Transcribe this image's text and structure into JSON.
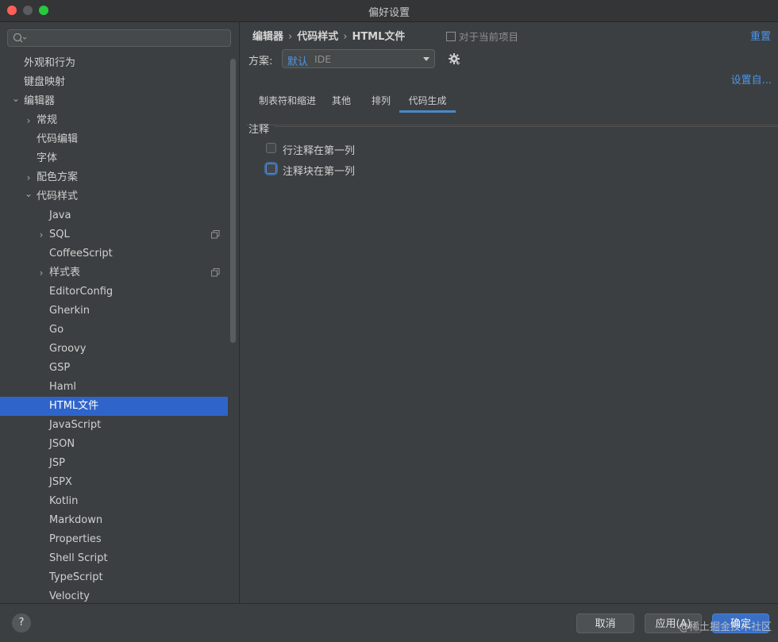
{
  "window": {
    "title": "偏好设置"
  },
  "search": {
    "placeholder": ""
  },
  "tree": [
    {
      "label": "外观和行为",
      "level": 0,
      "chevron": ""
    },
    {
      "label": "键盘映射",
      "level": 0,
      "chevron": ""
    },
    {
      "label": "编辑器",
      "level": 0,
      "chevron": "down"
    },
    {
      "label": "常规",
      "level": 1,
      "chevron": "right"
    },
    {
      "label": "代码编辑",
      "level": 1,
      "chevron": ""
    },
    {
      "label": "字体",
      "level": 1,
      "chevron": ""
    },
    {
      "label": "配色方案",
      "level": 1,
      "chevron": "right"
    },
    {
      "label": "代码样式",
      "level": 1,
      "chevron": "down"
    },
    {
      "label": "Java",
      "level": 2,
      "chevron": ""
    },
    {
      "label": "SQL",
      "level": 2,
      "chevron": "right",
      "copy": true
    },
    {
      "label": "CoffeeScript",
      "level": 2,
      "chevron": ""
    },
    {
      "label": "样式表",
      "level": 2,
      "chevron": "right",
      "copy": true
    },
    {
      "label": "EditorConfig",
      "level": 2,
      "chevron": ""
    },
    {
      "label": "Gherkin",
      "level": 2,
      "chevron": ""
    },
    {
      "label": "Go",
      "level": 2,
      "chevron": ""
    },
    {
      "label": "Groovy",
      "level": 2,
      "chevron": ""
    },
    {
      "label": "GSP",
      "level": 2,
      "chevron": ""
    },
    {
      "label": "Haml",
      "level": 2,
      "chevron": ""
    },
    {
      "label": "HTML文件",
      "level": 2,
      "chevron": "",
      "selected": true
    },
    {
      "label": "JavaScript",
      "level": 2,
      "chevron": ""
    },
    {
      "label": "JSON",
      "level": 2,
      "chevron": ""
    },
    {
      "label": "JSP",
      "level": 2,
      "chevron": ""
    },
    {
      "label": "JSPX",
      "level": 2,
      "chevron": ""
    },
    {
      "label": "Kotlin",
      "level": 2,
      "chevron": ""
    },
    {
      "label": "Markdown",
      "level": 2,
      "chevron": ""
    },
    {
      "label": "Properties",
      "level": 2,
      "chevron": ""
    },
    {
      "label": "Shell Script",
      "level": 2,
      "chevron": ""
    },
    {
      "label": "TypeScript",
      "level": 2,
      "chevron": ""
    },
    {
      "label": "Velocity",
      "level": 2,
      "chevron": ""
    }
  ],
  "breadcrumb": {
    "part1": "编辑器",
    "part2": "代码样式",
    "part3": "HTML文件",
    "sep": "›"
  },
  "project_scope": "对于当前项目",
  "reset_label": "重置",
  "scheme": {
    "label": "方案:",
    "value": "默认",
    "sub": "IDE"
  },
  "settings_link": "设置自...",
  "tabs": [
    {
      "label": "制表符和缩进",
      "active": false
    },
    {
      "label": "其他",
      "active": false
    },
    {
      "label": "排列",
      "active": false
    },
    {
      "label": "代码生成",
      "active": true
    }
  ],
  "comment_group": {
    "title": "注释",
    "options": [
      {
        "label": "行注释在第一列",
        "checked": false,
        "focused": false
      },
      {
        "label": "注释块在第一列",
        "checked": false,
        "focused": true
      }
    ]
  },
  "footer": {
    "help": "?",
    "cancel": "取消",
    "apply": "应用(A)",
    "ok": "确定",
    "watermark": "@稀土掘金技术社区"
  },
  "colors": {
    "accent": "#2f65ca",
    "link": "#4d94e8",
    "background": "#3c3f41"
  }
}
